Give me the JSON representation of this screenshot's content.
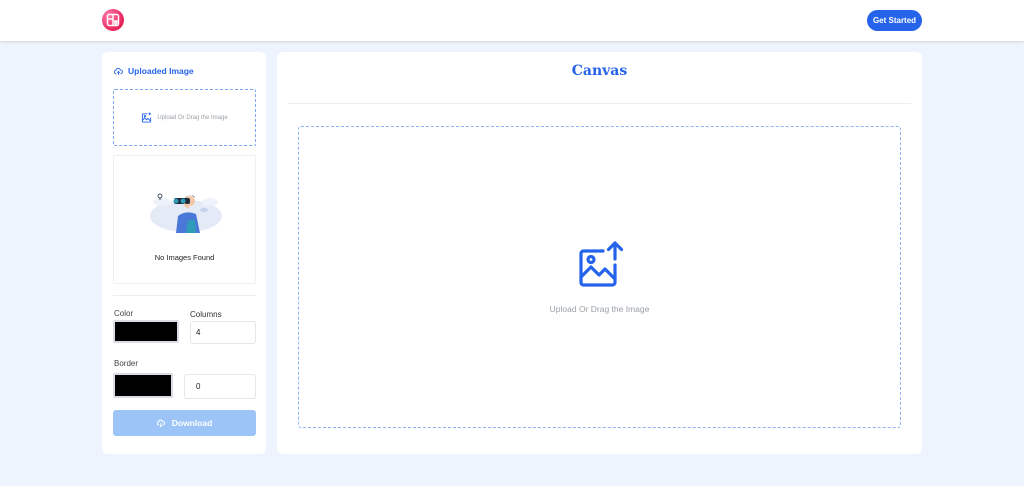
{
  "header": {
    "logo_icon": "collage-logo-icon",
    "get_started_label": "Get Started"
  },
  "sidebar": {
    "title": "Uploaded Image",
    "title_icon": "cloud-upload-icon",
    "upload_box_text": "Upload Or Drag the Image",
    "upload_box_icon": "image-add-icon",
    "empty_illustration": "binoculars-person-icon",
    "empty_text": "No Images Found",
    "color_label": "Color",
    "color_value": "#000000",
    "columns_label": "Columns",
    "columns_value": "4",
    "border_label": "Border",
    "border_color_value": "#000000",
    "border_width_value": "0",
    "download_label": "Download",
    "download_icon": "cloud-download-icon"
  },
  "canvas": {
    "title": "Canvas",
    "dropzone_text": "Upload Or Drag the Image",
    "dropzone_icon": "image-upload-icon"
  },
  "colors": {
    "accent": "#2563eb",
    "page_background": "#eef4fd",
    "download_disabled": "#9cc4f7"
  }
}
